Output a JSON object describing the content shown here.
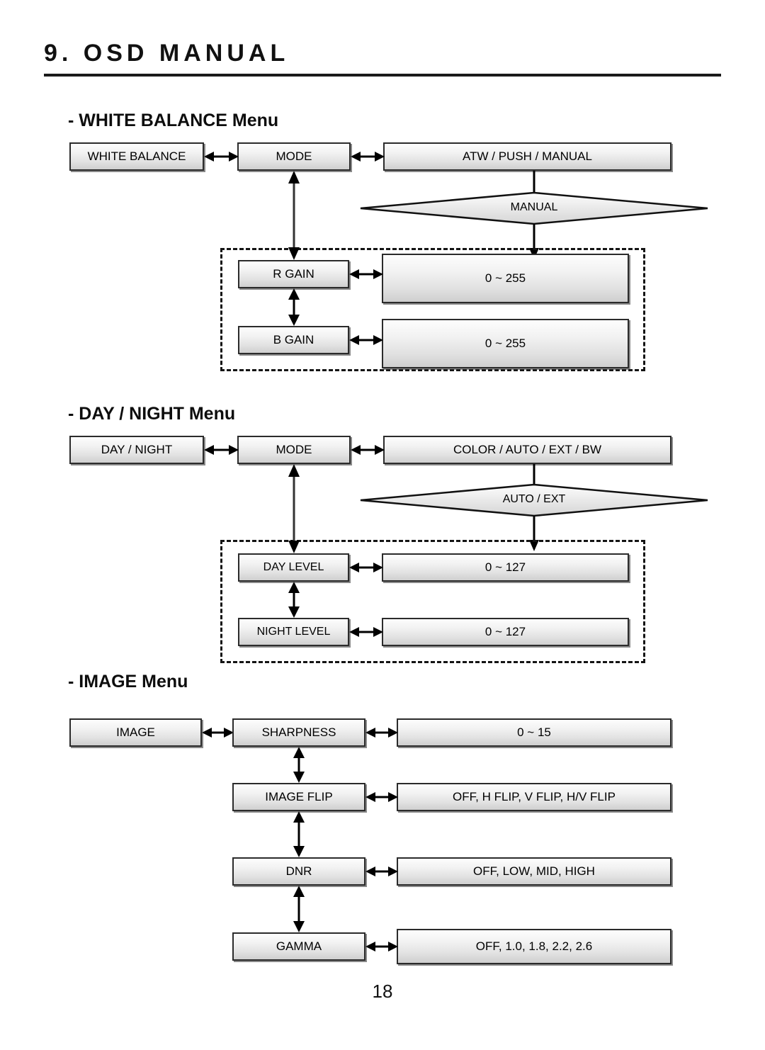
{
  "document": {
    "title": "9. OSD MANUAL",
    "page_number": "18"
  },
  "sections": [
    {
      "heading": "- WHITE BALANCE Menu",
      "root": "WHITE BALANCE",
      "mode_label": "MODE",
      "mode_values": "ATW / PUSH / MANUAL",
      "branch_condition": "MANUAL",
      "sub_rows": [
        {
          "label": "R GAIN",
          "value": "0 ~ 255"
        },
        {
          "label": "B GAIN",
          "value": "0 ~ 255"
        }
      ]
    },
    {
      "heading": "- DAY / NIGHT Menu",
      "root": "DAY / NIGHT",
      "mode_label": "MODE",
      "mode_values": "COLOR / AUTO / EXT / BW",
      "branch_condition": "AUTO / EXT",
      "sub_rows": [
        {
          "label": "DAY LEVEL",
          "value": "0 ~ 127"
        },
        {
          "label": "NIGHT LEVEL",
          "value": "0 ~ 127"
        }
      ]
    },
    {
      "heading": "- IMAGE Menu",
      "root": "IMAGE",
      "rows": [
        {
          "label": "SHARPNESS",
          "value": "0 ~ 15"
        },
        {
          "label": "IMAGE FLIP",
          "value": "OFF, H FLIP, V FLIP, H/V FLIP"
        },
        {
          "label": "DNR",
          "value": "OFF, LOW, MID, HIGH"
        },
        {
          "label": "GAMMA",
          "value": "OFF, 1.0, 1.8, 2.2, 2.6"
        }
      ]
    }
  ],
  "colors": {
    "ink": "#000000",
    "rule": "#1a1a1a",
    "box_border": "#2b2b2b",
    "box_fill_top": "#fdfdfd",
    "box_fill_bottom": "#cfcfcf"
  }
}
